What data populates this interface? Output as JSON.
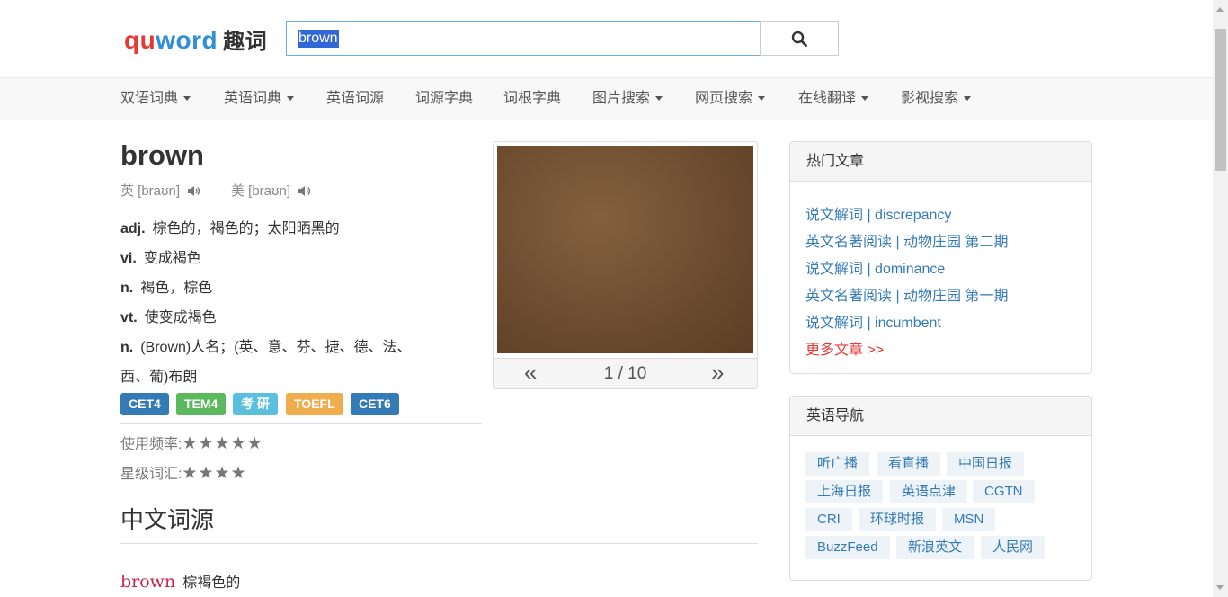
{
  "header": {
    "logo": {
      "part1": "qu",
      "part2": "word",
      "cn": "趣词"
    },
    "search": {
      "value": "brown"
    },
    "search_icon": "search-icon"
  },
  "nav": [
    {
      "label": "双语词典",
      "dropdown": true
    },
    {
      "label": "英语词典",
      "dropdown": true
    },
    {
      "label": "英语词源",
      "dropdown": false
    },
    {
      "label": "词源字典",
      "dropdown": false
    },
    {
      "label": "词根字典",
      "dropdown": false
    },
    {
      "label": "图片搜索",
      "dropdown": true
    },
    {
      "label": "网页搜索",
      "dropdown": true
    },
    {
      "label": "在线翻译",
      "dropdown": true
    },
    {
      "label": "影视搜索",
      "dropdown": true
    }
  ],
  "word": {
    "title": "brown",
    "pron_uk": "英 [braʊn]",
    "pron_us": "美 [braʊn]",
    "definitions": [
      {
        "pos": "adj.",
        "text": "棕色的，褐色的；太阳晒黑的"
      },
      {
        "pos": "vi.",
        "text": "变成褐色"
      },
      {
        "pos": "n.",
        "text": "褐色，棕色"
      },
      {
        "pos": "vt.",
        "text": "使变成褐色"
      },
      {
        "pos": "n.",
        "text": "(Brown)人名；(英、意、芬、捷、德、法、"
      }
    ],
    "definition_cont": "西、葡)布朗",
    "tags": [
      {
        "label": "CET4",
        "color": "#337ab7"
      },
      {
        "label": "TEM4",
        "color": "#5cb85c"
      },
      {
        "label": "考 研",
        "color": "#5bc0de"
      },
      {
        "label": "TOEFL",
        "color": "#f0ad4e"
      },
      {
        "label": "CET6",
        "color": "#337ab7"
      }
    ],
    "frequency_label": "使用频率:",
    "frequency_stars": "★★★★★",
    "level_label": "星级词汇:",
    "level_stars": "★★★★"
  },
  "image_panel": {
    "prev": "«",
    "next": "»",
    "counter": "1 / 10",
    "photo_color": "#6d4c2f"
  },
  "etymology": {
    "section_title": "中文词源",
    "word": "brown",
    "gloss": "棕褐色的"
  },
  "hot_articles": {
    "title": "热门文章",
    "items": [
      "说文解词 | discrepancy",
      "英文名著阅读 | 动物庄园 第二期",
      "说文解词 | dominance",
      "英文名著阅读 | 动物庄园 第一期",
      "说文解词 | incumbent"
    ],
    "more": "更多文章 >>"
  },
  "english_nav": {
    "title": "英语导航",
    "links": [
      "听广播",
      "看直播",
      "中国日报",
      "上海日报",
      "英语点津",
      "CGTN",
      "CRI",
      "环球时报",
      "MSN",
      "BuzzFeed",
      "新浪英文",
      "人民网"
    ]
  }
}
